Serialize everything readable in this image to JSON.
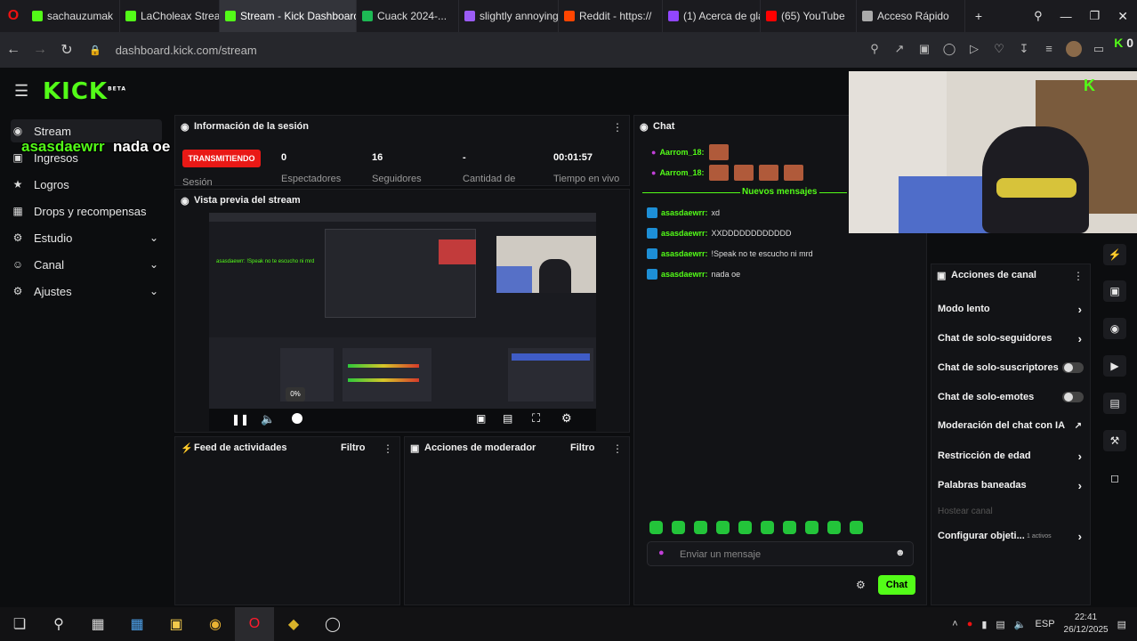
{
  "browser": {
    "tabs": [
      {
        "label": "sachauzumak",
        "favicon": "kick",
        "color": "#53fc18",
        "muted": true
      },
      {
        "label": "LaCholeax Stream",
        "favicon": "kick",
        "color": "#53fc18"
      },
      {
        "label": "Stream - Kick Dashboard",
        "favicon": "kick",
        "color": "#53fc18",
        "active": true
      },
      {
        "label": "Cuack 2024-...",
        "favicon": "spotify",
        "color": "#1db954"
      },
      {
        "label": "slightly annoying",
        "favicon": "tab",
        "color": "#9b5cf6"
      },
      {
        "label": "Reddit - https://",
        "favicon": "reddit",
        "color": "#ff4500"
      },
      {
        "label": "(1) Acerca de gla",
        "favicon": "twitch",
        "color": "#9146ff"
      },
      {
        "label": "(65) YouTube",
        "favicon": "youtube",
        "color": "#ff0000"
      },
      {
        "label": "Acceso Rápido",
        "favicon": "grid",
        "color": "#aaaaaa"
      }
    ],
    "url": "dashboard.kick.com/stream",
    "ext_count": "0"
  },
  "logo": "KICK",
  "logo_sup": "BETA",
  "sidebar": {
    "items": [
      {
        "label": "Stream",
        "icon": "broadcast-icon"
      },
      {
        "label": "Ingresos",
        "icon": "money-icon"
      },
      {
        "label": "Logros",
        "icon": "trophy-icon"
      },
      {
        "label": "Drops y recompensas",
        "icon": "gift-icon"
      },
      {
        "label": "Estudio",
        "icon": "gear-icon",
        "expand": true
      },
      {
        "label": "Canal",
        "icon": "people-icon",
        "expand": true
      },
      {
        "label": "Ajustes",
        "icon": "settings-icon",
        "expand": true
      }
    ]
  },
  "overlay": {
    "user": "asasdaewrr",
    "message": "nada oe"
  },
  "session": {
    "title": "Información de la sesión",
    "status": "TRANSMITIENDO",
    "status_sub": "Sesión",
    "stats": [
      {
        "value": "0",
        "label": "Espectadores"
      },
      {
        "value": "16",
        "label": "Seguidores"
      },
      {
        "value": "-",
        "label": "Cantidad de"
      },
      {
        "value": "00:01:57",
        "label": "Tiempo en vivo"
      }
    ]
  },
  "preview": {
    "title": "Vista previa del stream",
    "volume": "0%",
    "inner_chat": "asasdaewrr: !Speak no te escucho ni mrd"
  },
  "feed": {
    "title": "Feed de actividades",
    "filter": "Filtro"
  },
  "mod": {
    "title": "Acciones de moderador",
    "filter": "Filtro"
  },
  "chat": {
    "title": "Chat",
    "new_messages": "Nuevos mensajes",
    "top_lines": [
      {
        "user": "Aarrom_18:",
        "emotes": 1
      },
      {
        "user": "Aarrom_18:",
        "emotes": 4
      }
    ],
    "messages": [
      {
        "user": "asasdaewrr:",
        "text": "xd"
      },
      {
        "user": "asasdaewrr:",
        "text": "XXDDDDDDDDDDDD"
      },
      {
        "user": "asasdaewrr:",
        "text": "!Speak no te escucho ni mrd"
      },
      {
        "user": "asasdaewrr:",
        "text": "nada oe"
      }
    ],
    "placeholder": "Enviar un mensaje",
    "send": "Chat"
  },
  "actions": {
    "title": "Acciones de canal",
    "items": [
      {
        "label": "Modo lento",
        "type": "chev"
      },
      {
        "label": "Chat de solo-seguidores",
        "type": "chev"
      },
      {
        "label": "Chat de solo-suscriptores",
        "type": "toggle"
      },
      {
        "label": "Chat de solo-emotes",
        "type": "toggle"
      },
      {
        "label": "Moderación del chat con IA",
        "type": "ext"
      },
      {
        "label": "Restricción de edad",
        "type": "chev"
      },
      {
        "label": "Palabras baneadas",
        "type": "chev"
      },
      {
        "label": "Hostear canal",
        "type": "disabled"
      },
      {
        "label": "Configurar objeti...",
        "type": "chev",
        "badge": "1 activos"
      }
    ]
  },
  "taskbar": {
    "lang": "ESP",
    "time": "22:41",
    "date": "26/12/2025"
  }
}
